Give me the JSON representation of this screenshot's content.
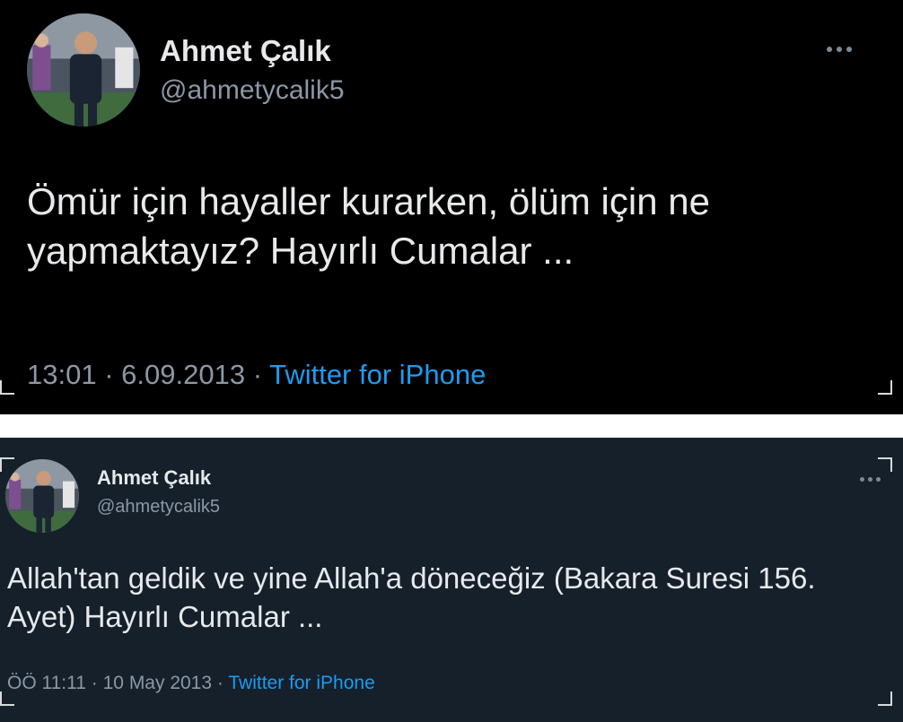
{
  "tweets": [
    {
      "author_name": "Ahmet Çalık",
      "author_handle": "@ahmetycalik5",
      "text": "Ömür için hayaller kurarken, ölüm için ne yapmaktayız? Hayırlı Cumalar ...",
      "time": "13:01",
      "date": "6.09.2013",
      "separator": "·",
      "source": "Twitter for iPhone",
      "background": "#000000"
    },
    {
      "author_name": "Ahmet Çalık",
      "author_handle": "@ahmetycalik5",
      "text": "Allah'tan geldik ve yine Allah'a döneceğiz (Bakara Suresi 156. Ayet) Hayırlı Cumalar ...",
      "time": "ÖÖ 11:11",
      "date": "10 May 2013",
      "separator": "·",
      "source": "Twitter for iPhone",
      "background": "#15202b"
    }
  ],
  "colors": {
    "text_primary": "#e7e9ea",
    "text_secondary": "#8b98a5",
    "link": "#1d9bf0"
  },
  "icons": {
    "more": "more-horizontal-icon",
    "avatar": "profile-photo"
  }
}
